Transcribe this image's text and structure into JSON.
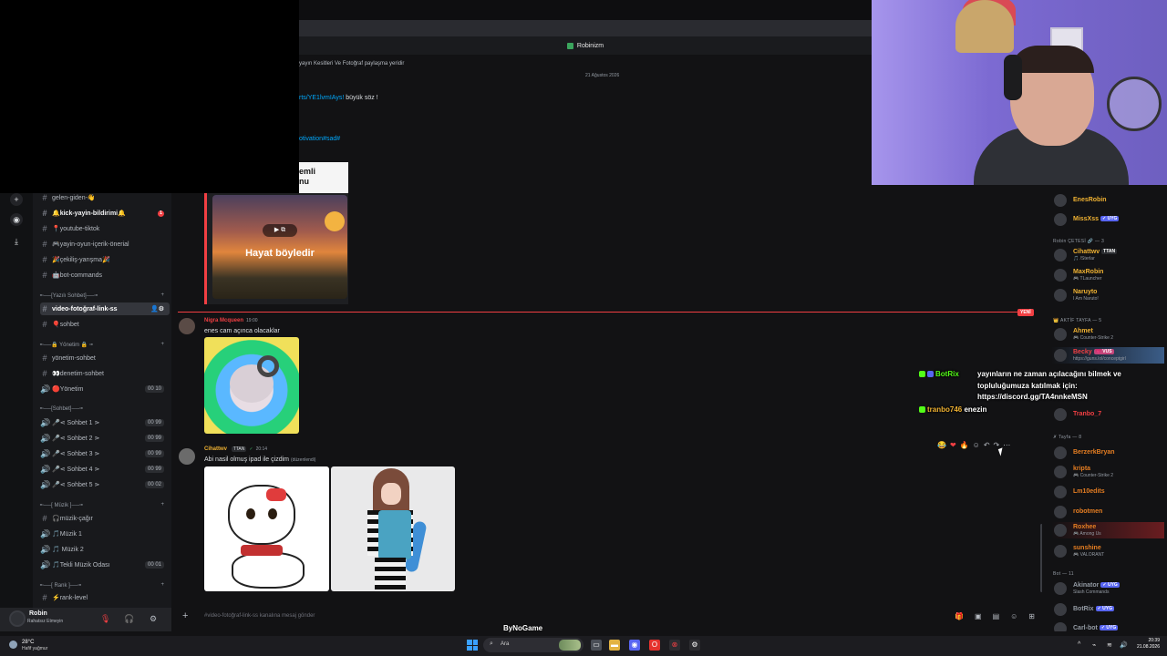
{
  "title_bar": {
    "server": "Robinizm"
  },
  "channel_topic": "yayın Kesitleri Ve Fotoğraf paylaşma yeridir",
  "date_divider": "21 Ağustos 2026",
  "messages": {
    "link_fragment": "rts/YE1lvmIAys!",
    "link_suffix": "büyük söz !",
    "tag_fragment": "otivation#sad#",
    "white_card": {
      "line1": "emli",
      "line2": "nu"
    },
    "embed_caption": "Hayat böyledir",
    "embed_play": "▶ ⧉",
    "new_label": "YENİ",
    "msg1": {
      "author": "Nigra Mcqueen",
      "time": "19:00",
      "text": "enes cam açınca olacaklar"
    },
    "msg2": {
      "author": "Cihattwv",
      "badge": "TTAN",
      "time": "20:14",
      "text": "Abi nasil olmuş ipad ile çizdim",
      "edited": "(düzenlendi)"
    }
  },
  "actions": [
    "😂",
    "❤",
    "🔥",
    "☺",
    "↶",
    "↷",
    "⋯"
  ],
  "chat_input": {
    "placeholder": "#video-fotoğraf-link-ss kanalına mesaj gönder"
  },
  "channels": [
    {
      "label": "gelen-giden-👋",
      "type": "text"
    },
    {
      "label": "🔔kick-yayin-bildirimi🔔",
      "type": "text",
      "bold": true,
      "badge": "1"
    },
    {
      "label": "📍youtube-tiktok",
      "type": "text"
    },
    {
      "label": "🎮yayin-oyun-içerik-önerial",
      "type": "text"
    },
    {
      "label": "🎉çekiliş-yarışma🎉",
      "type": "text"
    },
    {
      "label": "🤖bot-commands",
      "type": "text"
    },
    {
      "label": "video-fotoğraf-link-ss",
      "type": "text",
      "active": true
    },
    {
      "label": "🎈sohbet",
      "type": "text"
    },
    {
      "label": "yönetim-sohbet",
      "type": "text"
    },
    {
      "label": "👀denetim-sohbet",
      "type": "text"
    },
    {
      "label": "🔴Yönetim",
      "type": "voice",
      "count": "00 10"
    },
    {
      "label": "🎤⋖ Sohbet 1 ⋗",
      "type": "voice",
      "count": "00 99"
    },
    {
      "label": "🎤⋖ Sohbet 2 ⋗",
      "type": "voice",
      "count": "00 99"
    },
    {
      "label": "🎤⋖ Sohbet 3 ⋗",
      "type": "voice",
      "count": "00 99"
    },
    {
      "label": "🎤⋖ Sohbet 4 ⋗",
      "type": "voice",
      "count": "00 99"
    },
    {
      "label": "🎤⋖ Sohbet 5 ⋗",
      "type": "voice",
      "count": "00 02"
    },
    {
      "label": "🎧müzik-çağır",
      "type": "text"
    },
    {
      "label": "🎵Müzik 1",
      "type": "voice"
    },
    {
      "label": "🎵 Müzik 2",
      "type": "voice"
    },
    {
      "label": "🎵Tekli Müzik Odası",
      "type": "voice",
      "count": "00 01"
    },
    {
      "label": "⚡rank-level",
      "type": "text"
    }
  ],
  "categories": [
    "╾──[Yazılı Sohbet]──╼",
    "╾──🔒 Yönetim 🔒 ╼",
    "╾──[Sohbet]──╼",
    "╾──[ Müzik ]──╼",
    "╾──[ Rank ]──╼"
  ],
  "user_panel": {
    "name": "Robin",
    "status": "Rahatsız Etmeyin"
  },
  "members": {
    "top": [
      {
        "name": "EnesRobin",
        "color": "#f0b232"
      },
      {
        "name": "MissXss",
        "color": "#f0b232",
        "tag": "✓ UYG"
      }
    ],
    "group1": {
      "label": "Robin ÇETESİ 🔗 — 3"
    },
    "group1_members": [
      {
        "name": "Cihattwv",
        "color": "#f0b232",
        "tag": "TTAN",
        "activity": "🎵 /Sterlar"
      },
      {
        "name": "MaxRobin",
        "color": "#f0b232",
        "activity": "🎮 TLauncher"
      },
      {
        "name": "Naruyto",
        "color": "#f0b232",
        "activity": "I Am Naruto!"
      }
    ],
    "group2": {
      "label": "👑 AKTİF TAYFA — 5"
    },
    "group2_members": [
      {
        "name": "Ahmet",
        "color": "#f0b232",
        "activity": "🎮 Counter-Strike 2"
      },
      {
        "name": "Becky",
        "color": "#f23f43",
        "tag": "💗 VUS",
        "activity": "https://guns.lol/conceptgirl"
      },
      {
        "name": "Tranbo_7",
        "color": "#f23f43",
        "activity": ""
      }
    ],
    "group3": {
      "label": "✗ Tayfa — 8"
    },
    "group3_members": [
      {
        "name": "BerzerkBryan",
        "color": "#e67e22",
        "activity": ""
      },
      {
        "name": "kripta",
        "color": "#e67e22",
        "activity": "🎮 Counter-Strike 2"
      },
      {
        "name": "Lm10edits",
        "color": "#e67e22",
        "activity": ""
      },
      {
        "name": "robotmen",
        "color": "#e67e22",
        "activity": ""
      },
      {
        "name": "Roxhee",
        "color": "#e67e22",
        "activity": "🎮 Among Us"
      },
      {
        "name": "sunshine",
        "color": "#e67e22",
        "activity": "🎮 VALORANT"
      }
    ],
    "group4": {
      "label": "Bot — 11"
    },
    "group4_members": [
      {
        "name": "Akinator",
        "color": "#949ba4",
        "tag": "✓ UYG",
        "activity": "Slash Commands"
      },
      {
        "name": "BotRix",
        "color": "#949ba4",
        "tag": "✓ UYG",
        "activity": ""
      },
      {
        "name": "Carl-bot",
        "color": "#949ba4",
        "tag": "✓ UYG",
        "activity": ""
      }
    ]
  },
  "overlay": {
    "row1_user": "BotRix",
    "row1_text": "yayınların ne zaman açılacağını bilmek ve",
    "row2_text": "topluluğumuza katılmak için:",
    "row3_text": "https://discord.gg/TA4nnkeMSN",
    "row4_user": "tranbo746",
    "row4_text": "enezin"
  },
  "watermark": "ByNoGame",
  "taskbar": {
    "temp": "28°C",
    "weather": "Hafif yağmur",
    "search": "Ara",
    "time": "20:39",
    "date": "21.08.2026"
  },
  "colors": {
    "accent": "#5865f2",
    "red": "#f23f43",
    "link": "#00a8fc",
    "member_gold": "#f0b232"
  }
}
